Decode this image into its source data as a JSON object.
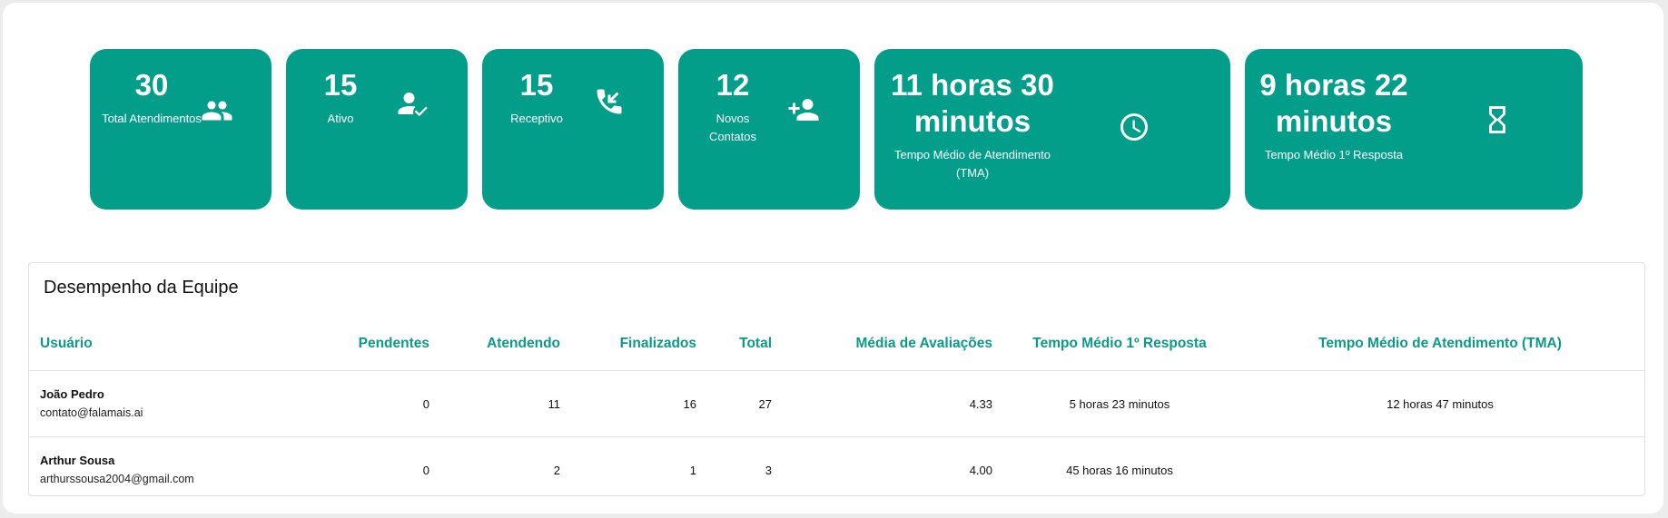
{
  "cards": [
    {
      "value": "30",
      "label": "Total Atendimentos",
      "icon": "people-icon"
    },
    {
      "value": "15",
      "label": "Ativo",
      "icon": "person-check-icon"
    },
    {
      "value": "15",
      "label": "Receptivo",
      "icon": "phone-incoming-icon"
    },
    {
      "value": "12",
      "label": "Novos Contatos",
      "icon": "person-add-icon"
    },
    {
      "value": "11 horas 30 minutos",
      "label": "Tempo Médio de Atendimento (TMA)",
      "icon": "clock-icon"
    },
    {
      "value": "9 horas 22 minutos",
      "label": "Tempo Médio 1º Resposta",
      "icon": "hourglass-icon"
    }
  ],
  "team": {
    "title": "Desempenho da Equipe",
    "columns": {
      "user": "Usuário",
      "pending": "Pendentes",
      "attending": "Atendendo",
      "finished": "Finalizados",
      "total": "Total",
      "rating": "Média de Avaliações",
      "first_response": "Tempo Médio 1º Resposta",
      "tma": "Tempo Médio de Atendimento (TMA)"
    },
    "rows": [
      {
        "name": "João Pedro",
        "email": "contato@falamais.ai",
        "pending": "0",
        "attending": "11",
        "finished": "16",
        "total": "27",
        "rating": "4.33",
        "first_response": "5 horas 23 minutos",
        "tma": "12 horas 47 minutos"
      },
      {
        "name": "Arthur Sousa",
        "email": "arthurssousa2004@gmail.com",
        "pending": "0",
        "attending": "2",
        "finished": "1",
        "total": "3",
        "rating": "4.00",
        "first_response": "45 horas 16 minutos",
        "tma": ""
      }
    ]
  },
  "colors": {
    "accent": "#039e8a",
    "header_text": "#0a9b88"
  }
}
